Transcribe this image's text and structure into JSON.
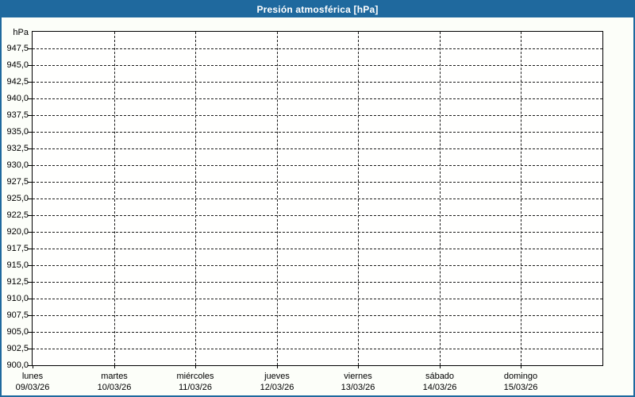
{
  "window": {
    "title": "Presión atmosférica [hPa]"
  },
  "colors": {
    "titlebar_bg": "#1f699e",
    "titlebar_text": "#ffffff",
    "frame_border": "#1f699e",
    "page_bg": "#fcfef9",
    "plot_bg": "#fffffe",
    "grid_color": "#1a1a1a"
  },
  "chart_data": {
    "type": "line",
    "title": "Presión atmosférica [hPa]",
    "ylabel": "hPa",
    "xlabel": "",
    "ylim": [
      900,
      950
    ],
    "ytick_step": 2.5,
    "grid": "dashed",
    "legend": "none",
    "yticks": [
      {
        "value": 947.5,
        "label": "947,5"
      },
      {
        "value": 945.0,
        "label": "945,0"
      },
      {
        "value": 942.5,
        "label": "942,5"
      },
      {
        "value": 940.0,
        "label": "940,0"
      },
      {
        "value": 937.5,
        "label": "937,5"
      },
      {
        "value": 935.0,
        "label": "935,0"
      },
      {
        "value": 932.5,
        "label": "932,5"
      },
      {
        "value": 930.0,
        "label": "930,0"
      },
      {
        "value": 927.5,
        "label": "927,5"
      },
      {
        "value": 925.0,
        "label": "925,0"
      },
      {
        "value": 922.5,
        "label": "922,5"
      },
      {
        "value": 920.0,
        "label": "920,0"
      },
      {
        "value": 917.5,
        "label": "917,5"
      },
      {
        "value": 915.0,
        "label": "915,0"
      },
      {
        "value": 912.5,
        "label": "912,5"
      },
      {
        "value": 910.0,
        "label": "910,0"
      },
      {
        "value": 907.5,
        "label": "907,5"
      },
      {
        "value": 905.0,
        "label": "905,0"
      },
      {
        "value": 902.5,
        "label": "902,5"
      },
      {
        "value": 900.0,
        "label": "900,0"
      }
    ],
    "x_categories": [
      {
        "day": "lunes",
        "date": "09/03/26"
      },
      {
        "day": "martes",
        "date": "10/03/26"
      },
      {
        "day": "miércoles",
        "date": "11/03/26"
      },
      {
        "day": "jueves",
        "date": "12/03/26"
      },
      {
        "day": "viernes",
        "date": "13/03/26"
      },
      {
        "day": "sábado",
        "date": "14/03/26"
      },
      {
        "day": "domingo",
        "date": "15/03/26"
      }
    ],
    "series": []
  }
}
